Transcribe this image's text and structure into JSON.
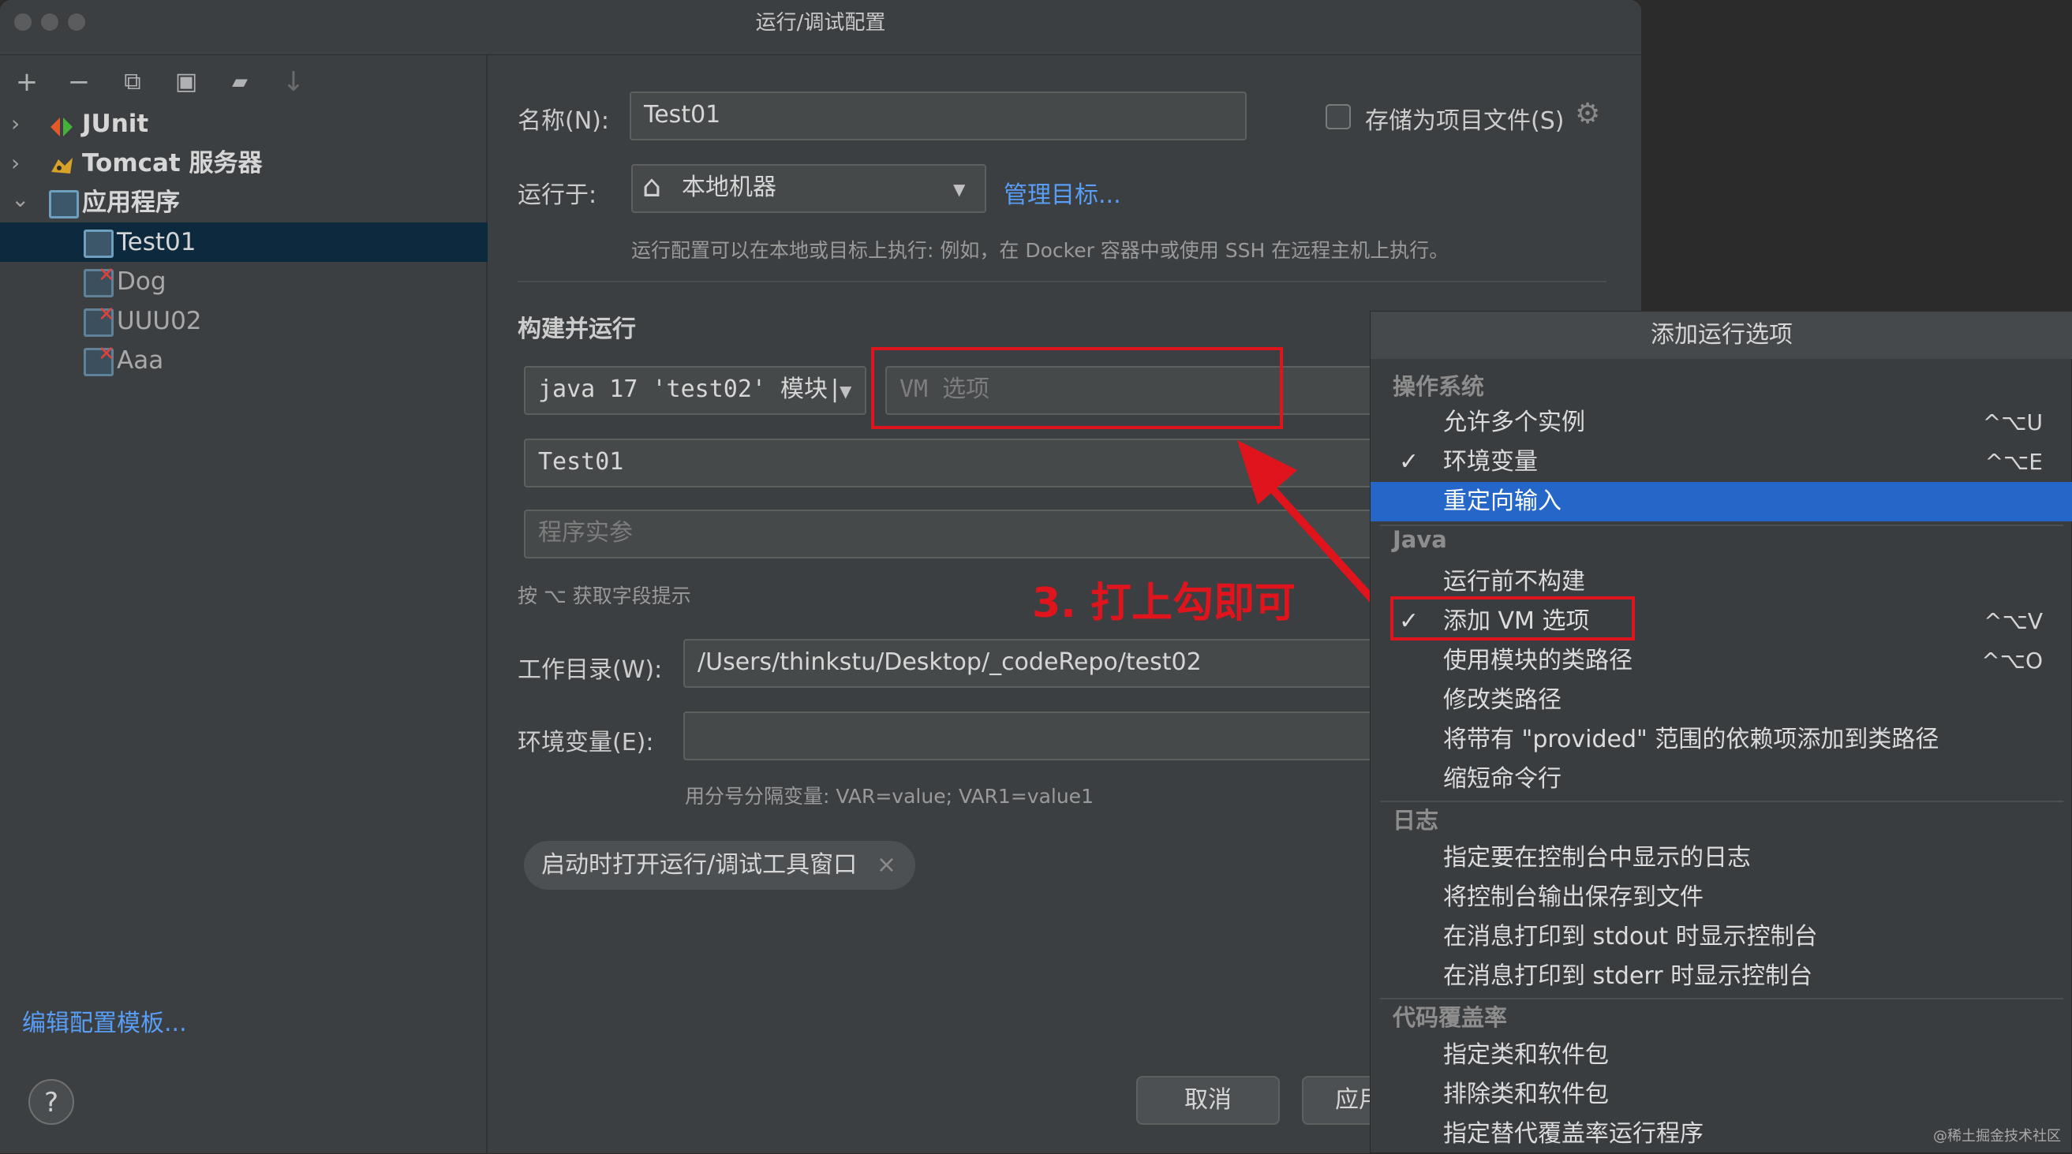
{
  "window": {
    "title": "运行/调试配置"
  },
  "toolbar": {
    "icons": [
      "plus-icon",
      "minus-icon",
      "copy-icon",
      "save-icon",
      "folder-add-icon",
      "sort-icon"
    ],
    "glyphs": [
      "+",
      "−",
      "⧉",
      "▣",
      "▰",
      "↓"
    ]
  },
  "tree": {
    "groups": [
      {
        "label": "JUnit",
        "expanded": false
      },
      {
        "label": "Tomcat 服务器",
        "expanded": false
      },
      {
        "label": "应用程序",
        "expanded": true
      }
    ],
    "configs": [
      {
        "label": "Test01",
        "selected": true,
        "error": false
      },
      {
        "label": "Dog",
        "selected": false,
        "error": true
      },
      {
        "label": "UUU02",
        "selected": false,
        "error": true
      },
      {
        "label": "Aaa",
        "selected": false,
        "error": true
      }
    ],
    "chevron_collapsed": "›",
    "chevron_expanded": "⌄",
    "error_mark": "✕"
  },
  "left_footer": {
    "edit_templates": "编辑配置模板...",
    "help": "?"
  },
  "form": {
    "name_label": "名称(N):",
    "name_value": "Test01",
    "store_label": "存储为项目文件(S)",
    "gear": "⚙",
    "run_on_label": "运行于:",
    "run_on_value": "本地机器",
    "home_glyph": "⌂",
    "dropdown_glyph": "▼",
    "manage_targets": "管理目标...",
    "run_on_hint": "运行配置可以在本地或目标上执行: 例如，在 Docker 容器中或使用 SSH 在远程主机上执行。",
    "section_build_run": "构建并运行",
    "jdk_value": "java 17 'test02' 模块|",
    "vm_placeholder": "VM 选项",
    "main_class": "Test01",
    "program_args_placeholder": "程序实参",
    "field_hint": "按 ⌥ 获取字段提示",
    "workdir_label": "工作目录(W):",
    "workdir_value": "/Users/thinkstu/Desktop/_codeRepo/test02",
    "env_label": "环境变量(E):",
    "env_value": "",
    "env_hint": "用分号分隔变量: VAR=value; VAR1=value1",
    "chip_label": "启动时打开运行/调试工具窗口",
    "chip_close": "×"
  },
  "buttons": {
    "cancel": "取消",
    "apply": "应用"
  },
  "annotation": {
    "text": "3. 打上勾即可",
    "color": "#e0141c"
  },
  "popup": {
    "title": "添加运行选项",
    "groups": {
      "os": "操作系统",
      "java": "Java",
      "log": "日志",
      "coverage": "代码覆盖率"
    },
    "os_items": [
      {
        "label": "允许多个实例",
        "key": "^⌥U",
        "checked": false,
        "highlight": false
      },
      {
        "label": "环境变量",
        "key": "^⌥E",
        "checked": true,
        "highlight": false
      },
      {
        "label": "重定向输入",
        "key": "",
        "checked": false,
        "highlight": true
      }
    ],
    "java_items": [
      {
        "label": "运行前不构建",
        "key": "",
        "checked": false
      },
      {
        "label": "添加 VM 选项",
        "key": "^⌥V",
        "checked": true
      },
      {
        "label": "使用模块的类路径",
        "key": "^⌥O",
        "checked": false
      },
      {
        "label": "修改类路径",
        "key": "",
        "checked": false
      },
      {
        "label": "将带有 \"provided\" 范围的依赖项添加到类路径",
        "key": "",
        "checked": false
      },
      {
        "label": "缩短命令行",
        "key": "",
        "checked": false
      }
    ],
    "log_items": [
      {
        "label": "指定要在控制台中显示的日志"
      },
      {
        "label": "将控制台输出保存到文件"
      },
      {
        "label": "在消息打印到 stdout 时显示控制台"
      },
      {
        "label": "在消息打印到 stderr 时显示控制台"
      }
    ],
    "coverage_items": [
      {
        "label": "指定类和软件包"
      },
      {
        "label": "排除类和软件包"
      },
      {
        "label": "指定替代覆盖率运行程序"
      }
    ],
    "check_glyph": "✓",
    "highlight_color": "#2566c9"
  },
  "watermark": "@稀土掘金技术社区"
}
